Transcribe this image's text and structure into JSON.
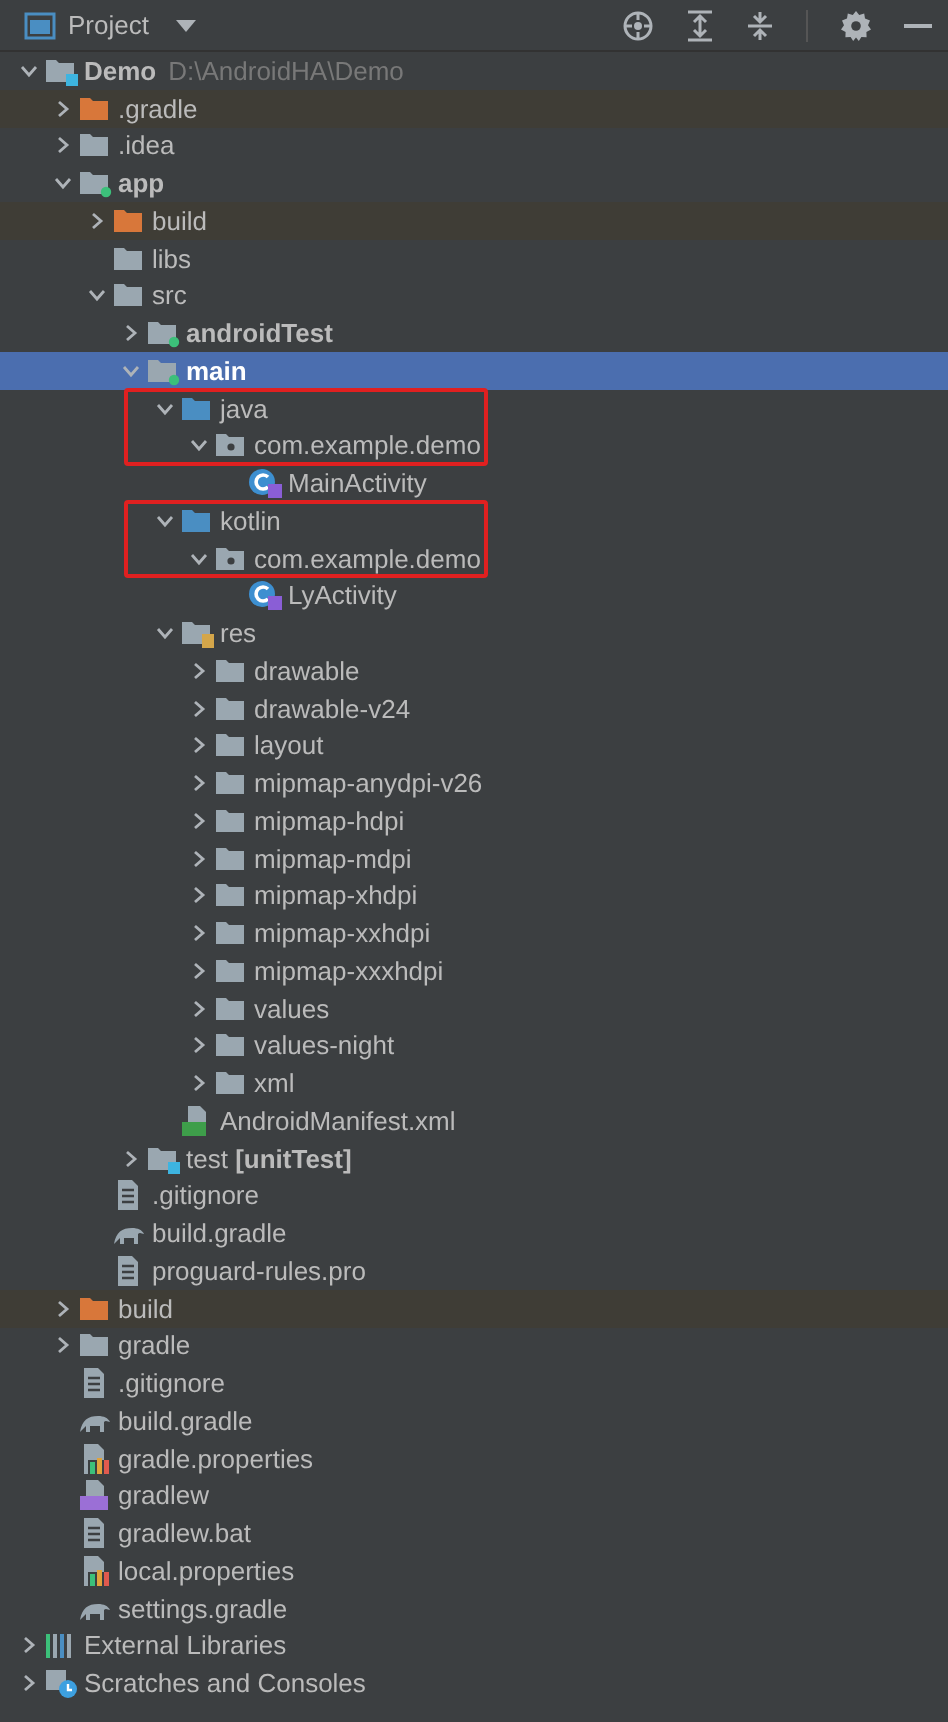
{
  "header": {
    "title": "Project"
  },
  "tree": [
    {
      "label": "Demo",
      "kind": "project",
      "bold": true,
      "hint": "D:\\AndroidHA\\Demo",
      "expanded": true,
      "selected": false,
      "children": [
        {
          "label": ".gradle",
          "kind": "excluded_folder",
          "expanded": false,
          "selected": false
        },
        {
          "label": ".idea",
          "kind": "folder",
          "expanded": false,
          "selected": false
        },
        {
          "label": "app",
          "kind": "module",
          "bold": true,
          "expanded": true,
          "selected": false,
          "children": [
            {
              "label": "build",
              "kind": "excluded_folder",
              "expanded": false,
              "selected": false
            },
            {
              "label": "libs",
              "kind": "folder",
              "selected": false
            },
            {
              "label": "src",
              "kind": "folder",
              "expanded": true,
              "selected": false,
              "children": [
                {
                  "label": "androidTest",
                  "kind": "module",
                  "bold": true,
                  "expanded": false,
                  "selected": false
                },
                {
                  "label": "main",
                  "kind": "module",
                  "bold": true,
                  "expanded": true,
                  "selected": true,
                  "children": [
                    {
                      "label": "java",
                      "kind": "source_root",
                      "expanded": true,
                      "selected": false,
                      "outlined": true,
                      "children": [
                        {
                          "label": "com.example.demo",
                          "kind": "package",
                          "expanded": true,
                          "selected": false,
                          "children": [
                            {
                              "label": "MainActivity",
                              "kind": "kotlin_class",
                              "selected": false
                            }
                          ]
                        }
                      ]
                    },
                    {
                      "label": "kotlin",
                      "kind": "source_root",
                      "expanded": true,
                      "selected": false,
                      "outlined": true,
                      "children": [
                        {
                          "label": "com.example.demo",
                          "kind": "package",
                          "expanded": true,
                          "selected": false,
                          "children": [
                            {
                              "label": "LyActivity",
                              "kind": "kotlin_class",
                              "selected": false
                            }
                          ]
                        }
                      ]
                    },
                    {
                      "label": "res",
                      "kind": "resources",
                      "expanded": true,
                      "selected": false,
                      "children": [
                        {
                          "label": "drawable",
                          "kind": "folder",
                          "expanded": false,
                          "selected": false
                        },
                        {
                          "label": "drawable-v24",
                          "kind": "folder",
                          "expanded": false,
                          "selected": false
                        },
                        {
                          "label": "layout",
                          "kind": "folder",
                          "expanded": false,
                          "selected": false
                        },
                        {
                          "label": "mipmap-anydpi-v26",
                          "kind": "folder",
                          "expanded": false,
                          "selected": false
                        },
                        {
                          "label": "mipmap-hdpi",
                          "kind": "folder",
                          "expanded": false,
                          "selected": false
                        },
                        {
                          "label": "mipmap-mdpi",
                          "kind": "folder",
                          "expanded": false,
                          "selected": false
                        },
                        {
                          "label": "mipmap-xhdpi",
                          "kind": "folder",
                          "expanded": false,
                          "selected": false
                        },
                        {
                          "label": "mipmap-xxhdpi",
                          "kind": "folder",
                          "expanded": false,
                          "selected": false
                        },
                        {
                          "label": "mipmap-xxxhdpi",
                          "kind": "folder",
                          "expanded": false,
                          "selected": false
                        },
                        {
                          "label": "values",
                          "kind": "folder",
                          "expanded": false,
                          "selected": false
                        },
                        {
                          "label": "values-night",
                          "kind": "folder",
                          "expanded": false,
                          "selected": false
                        },
                        {
                          "label": "xml",
                          "kind": "folder",
                          "expanded": false,
                          "selected": false
                        }
                      ]
                    },
                    {
                      "label": "AndroidManifest.xml",
                      "kind": "manifest",
                      "selected": false
                    }
                  ]
                },
                {
                  "label": "test **[unitTest]**",
                  "kind": "test_root",
                  "expanded": false,
                  "selected": false
                }
              ]
            },
            {
              "label": ".gitignore",
              "kind": "text_file",
              "selected": false
            },
            {
              "label": "build.gradle",
              "kind": "gradle_file",
              "selected": false
            },
            {
              "label": "proguard-rules.pro",
              "kind": "text_file",
              "selected": false
            }
          ]
        },
        {
          "label": "build",
          "kind": "excluded_folder",
          "expanded": false,
          "selected": false
        },
        {
          "label": "gradle",
          "kind": "folder",
          "expanded": false,
          "selected": false
        },
        {
          "label": ".gitignore",
          "kind": "text_file",
          "selected": false
        },
        {
          "label": "build.gradle",
          "kind": "gradle_file",
          "selected": false
        },
        {
          "label": "gradle.properties",
          "kind": "properties",
          "selected": false
        },
        {
          "label": "gradlew",
          "kind": "script",
          "selected": false
        },
        {
          "label": "gradlew.bat",
          "kind": "text_file",
          "selected": false
        },
        {
          "label": "local.properties",
          "kind": "properties",
          "selected": false
        },
        {
          "label": "settings.gradle",
          "kind": "gradle_file",
          "selected": false
        }
      ]
    },
    {
      "label": "External Libraries",
      "kind": "libraries",
      "expanded": false,
      "selected": false
    },
    {
      "label": "Scratches and Consoles",
      "kind": "scratches",
      "expanded": false,
      "selected": false
    }
  ]
}
